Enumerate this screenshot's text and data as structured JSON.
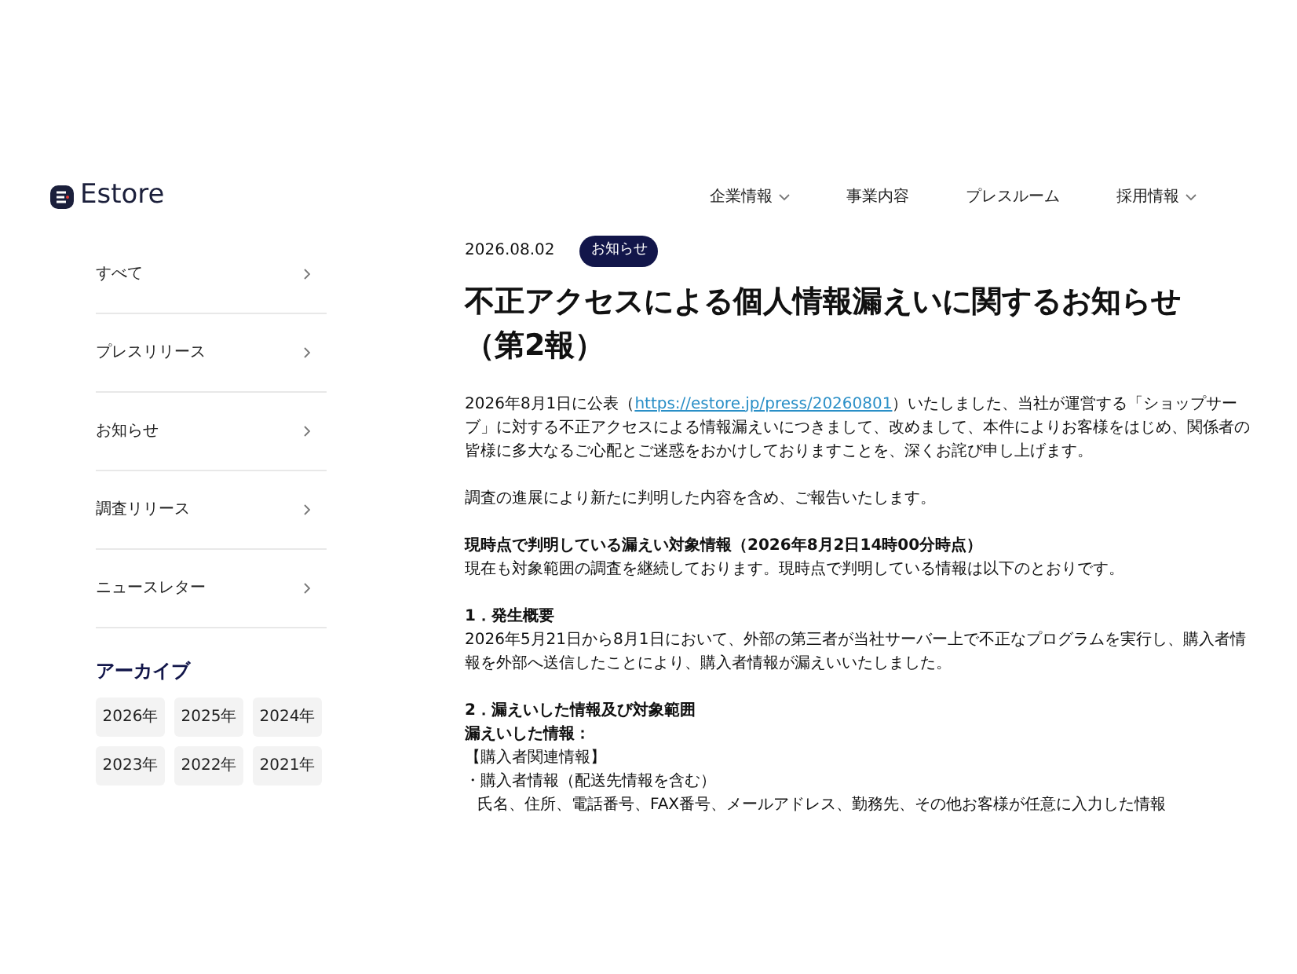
{
  "header": {
    "logo": "Estore",
    "nav": [
      {
        "label": "企業情報",
        "dropdown": true
      },
      {
        "label": "事業内容",
        "dropdown": false
      },
      {
        "label": "プレスルーム",
        "dropdown": false
      },
      {
        "label": "採用情報",
        "dropdown": true
      }
    ]
  },
  "sidebar": {
    "categories": [
      {
        "label": "すべて"
      },
      {
        "label": "プレスリリース"
      },
      {
        "label": "お知らせ"
      },
      {
        "label": "調査リリース"
      },
      {
        "label": "ニュースレター"
      }
    ],
    "archive": {
      "title": "アーカイブ",
      "years": [
        "2026年",
        "2025年",
        "2024年",
        "2023年",
        "2022年",
        "2021年"
      ]
    }
  },
  "article": {
    "date": "2026.08.02",
    "category": "お知らせ",
    "title": "不正アクセスによる個人情報漏えいに関するお知らせ（第2報）",
    "sections": [
      [
        {
          "kind": "link_paragraph",
          "before": "2026年8月1日に公表（",
          "link": "https://estore.jp/press/20260801",
          "after": "）いたしました、当社が運営する「ショップサーブ」に対する不正アクセスによる情報漏えいにつきまして、改めまして、本件によりお客様をはじめ、関係者の皆様に多大なるご心配とご迷惑をおかけしておりますことを、深くお詫び申し上げます。"
        }
      ],
      [
        {
          "kind": "text",
          "text": "調査の進展により新たに判明した内容を含め、ご報告いたします。"
        }
      ],
      [
        {
          "kind": "heading",
          "text": "現時点で判明している漏えい対象情報（2026年8月2日14時00分時点）"
        },
        {
          "kind": "text",
          "text": "現在も対象範囲の調査を継続しております。現時点で判明している情報は以下のとおりです。"
        }
      ],
      [
        {
          "kind": "heading",
          "text": "1．発生概要"
        },
        {
          "kind": "text",
          "text": "2026年5月21日から8月1日において、外部の第三者が当社サーバー上で不正なプログラムを実行し、購入者情報を外部へ送信したことにより、購入者情報が漏えいいたしました。"
        }
      ],
      [
        {
          "kind": "heading",
          "text": "2．漏えいした情報及び対象範囲"
        },
        {
          "kind": "heading",
          "text": "漏えいした情報："
        },
        {
          "kind": "text",
          "text": "【購入者関連情報】"
        },
        {
          "kind": "text",
          "text": "・購入者情報（配送先情報を含む）"
        },
        {
          "kind": "indent",
          "text": "氏名、住所、電話番号、FAX番号、メールアドレス、勤務先、その他お客様が任意に入力した情報"
        }
      ]
    ]
  }
}
